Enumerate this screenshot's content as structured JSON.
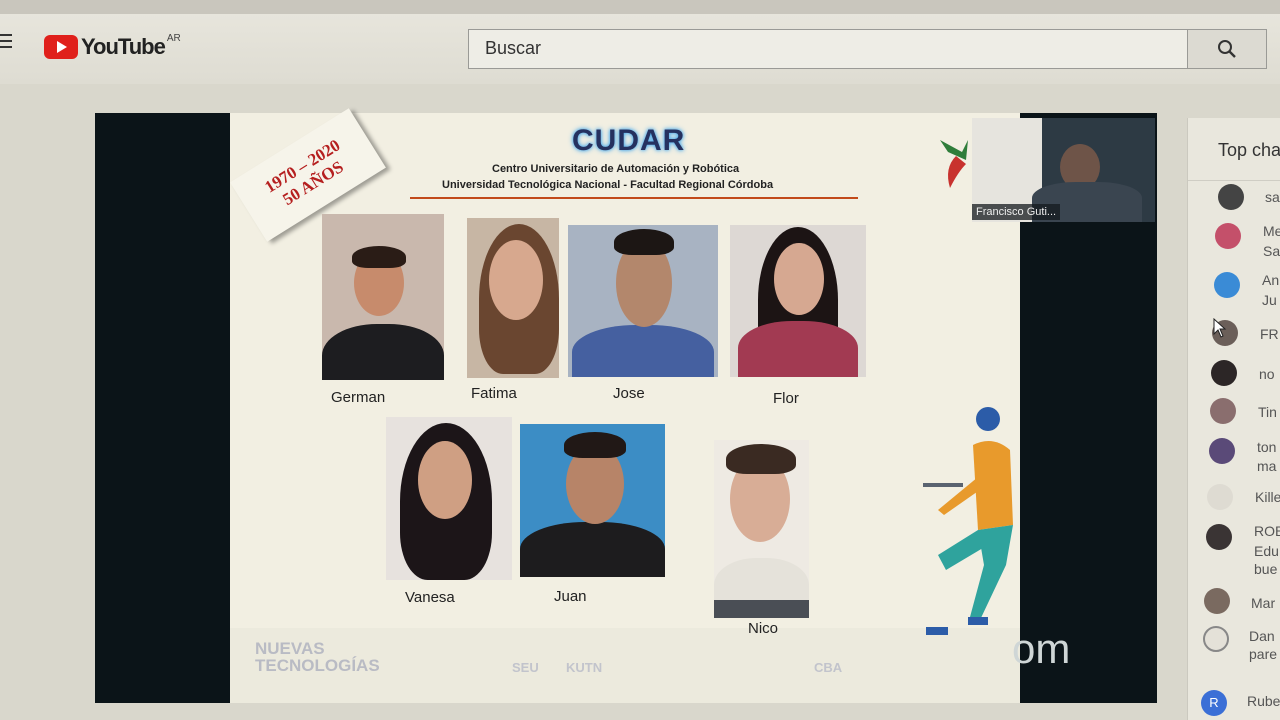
{
  "header": {
    "logo_text": "YouTube",
    "region": "AR",
    "search_placeholder": "Buscar"
  },
  "slide": {
    "title": "CUDAR",
    "subtitle_line1": "Centro Universitario de  Automación y Robótica",
    "subtitle_line2": "Universidad Tecnológica Nacional  -  Facultad Regional Córdoba",
    "stamp_years": "1970 – 2020",
    "stamp_label": "50 AÑOS",
    "people": [
      "German",
      "Fatima",
      "Jose",
      "Flor",
      "Vanesa",
      "Juan",
      "Nico"
    ],
    "footer_logo_line1": "NUEVAS",
    "footer_logo_line2": "TECNOLOGÍAS",
    "footer_logo_seu": "SEU",
    "footer_logo_kutn": "KUTN",
    "footer_logo_cba": "CBA",
    "zoom_partial": "om"
  },
  "pip": {
    "participant_name": "Francisco Guti..."
  },
  "chat": {
    "title": "Top cha",
    "messages": [
      {
        "author": "sa",
        "text": ""
      },
      {
        "author": "Me",
        "text": "Sa"
      },
      {
        "author": "An",
        "text": "Ju"
      },
      {
        "author": "FR",
        "text": ""
      },
      {
        "author": "no",
        "text": ""
      },
      {
        "author": "Tin",
        "text": ""
      },
      {
        "author": "ton",
        "text": "ma"
      },
      {
        "author": "Kille",
        "text": ""
      },
      {
        "author": "ROB",
        "text": "Edu bue"
      },
      {
        "author": "Mar",
        "text": ""
      },
      {
        "author": "Dan",
        "text": "pare"
      },
      {
        "author": "Rube",
        "text": ""
      }
    ],
    "avatar_letter": "R"
  },
  "colors": {
    "youtube_red": "#e0201b",
    "stamp_red": "#b51f1f",
    "cudar_blue": "#25315f",
    "accent_line": "#c24a1a"
  }
}
